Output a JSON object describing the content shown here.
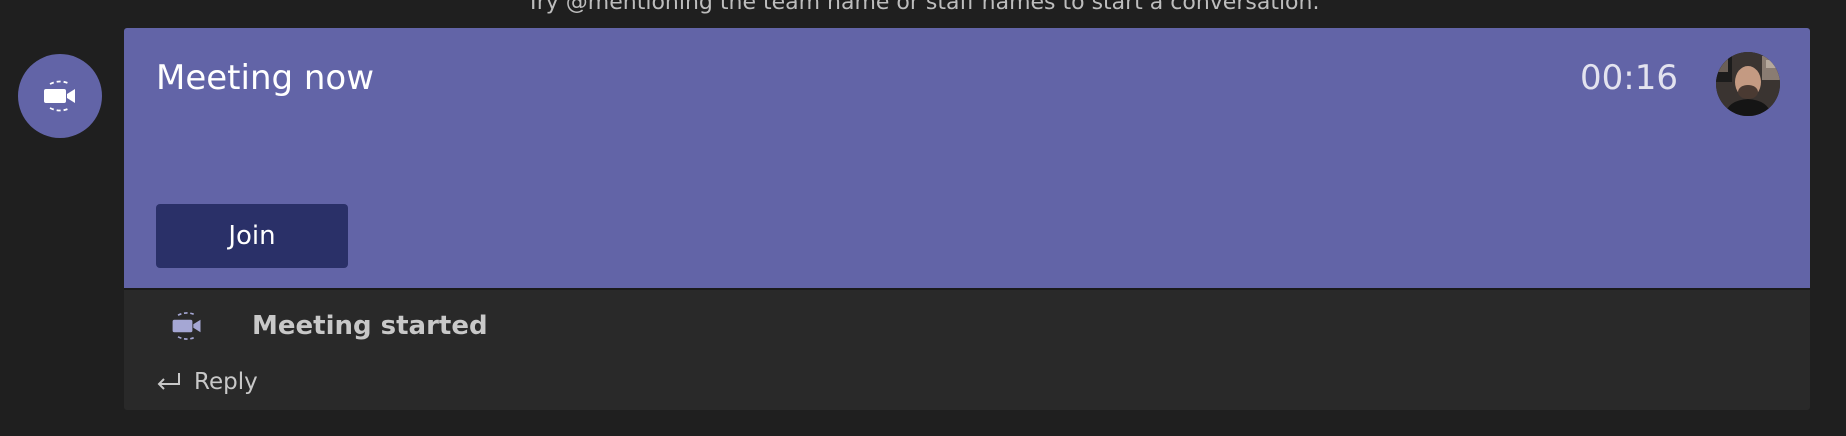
{
  "channel": {
    "hint_text": "Try @mentioning the team name or staff names to start a conversation."
  },
  "meeting_card": {
    "icon": "video-camera-icon",
    "title": "Meeting now",
    "timer": "00:16",
    "organizer_avatar": "organizer-photo",
    "join_label": "Join",
    "accent_color": "#6264a7",
    "join_color": "#2a3068"
  },
  "activity": {
    "icon": "video-camera-icon",
    "status_text": "Meeting started",
    "reply_icon": "reply-arrow-icon",
    "reply_label": "Reply"
  }
}
